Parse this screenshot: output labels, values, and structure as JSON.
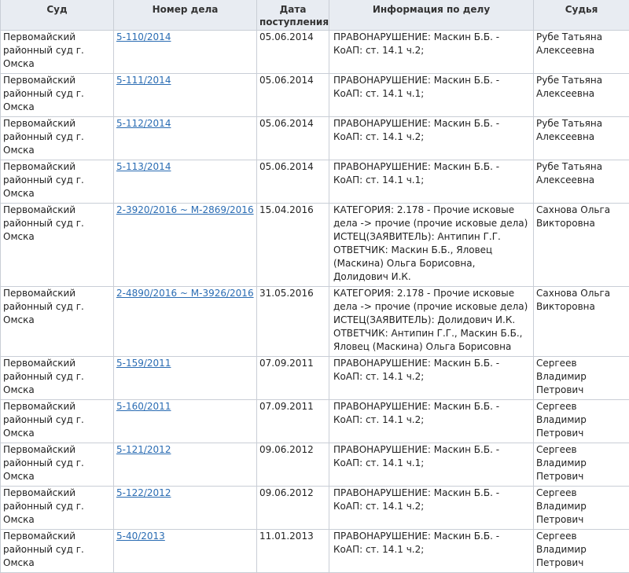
{
  "headers": [
    "Суд",
    "Номер дела",
    "Дата поступления",
    "Информация по делу",
    "Судья"
  ],
  "rows": [
    {
      "court": "Первомайский районный суд г. Омска",
      "case": "5-110/2014",
      "date": "05.06.2014",
      "info": "ПРАВОНАРУШЕНИЕ: Маскин Б.Б. - КоАП: ст. 14.1 ч.2;",
      "judge": "Рубе Татьяна Алексеевна"
    },
    {
      "court": "Первомайский районный суд г. Омска",
      "case": "5-111/2014",
      "date": "05.06.2014",
      "info": "ПРАВОНАРУШЕНИЕ: Маскин Б.Б. - КоАП: ст. 14.1 ч.1;",
      "judge": "Рубе Татьяна Алексеевна"
    },
    {
      "court": "Первомайский районный суд г. Омска",
      "case": "5-112/2014",
      "date": "05.06.2014",
      "info": "ПРАВОНАРУШЕНИЕ: Маскин Б.Б. - КоАП: ст. 14.1 ч.2;",
      "judge": "Рубе Татьяна Алексеевна"
    },
    {
      "court": "Первомайский районный суд г. Омска",
      "case": "5-113/2014",
      "date": "05.06.2014",
      "info": "ПРАВОНАРУШЕНИЕ: Маскин Б.Б. - КоАП: ст. 14.1 ч.1;",
      "judge": "Рубе Татьяна Алексеевна"
    },
    {
      "court": "Первомайский районный суд г. Омска",
      "case": "2-3920/2016 ~ М-2869/2016",
      "date": "15.04.2016",
      "info": "КАТЕГОРИЯ: 2.178 - Прочие исковые дела -> прочие (прочие исковые дела) ИСТЕЦ(ЗАЯВИТЕЛЬ): Антипин Г.Г. ОТВЕТЧИК: Маскин Б.Б., Яловец (Маскина) Ольга Борисовна, Долидович И.К.",
      "judge": "Сахнова Ольга Викторовна"
    },
    {
      "court": "Первомайский районный суд г. Омска",
      "case": "2-4890/2016 ~ М-3926/2016",
      "date": "31.05.2016",
      "info": "КАТЕГОРИЯ: 2.178 - Прочие исковые дела -> прочие (прочие исковые дела) ИСТЕЦ(ЗАЯВИТЕЛЬ): Долидович И.К. ОТВЕТЧИК: Антипин Г.Г., Маскин Б.Б., Яловец (Маскина) Ольга Борисовна",
      "judge": "Сахнова Ольга Викторовна"
    },
    {
      "court": "Первомайский районный суд г. Омска",
      "case": "5-159/2011",
      "date": "07.09.2011",
      "info": "ПРАВОНАРУШЕНИЕ: Маскин Б.Б. - КоАП: ст. 14.1 ч.2;",
      "judge": "Сергеев Владимир Петрович"
    },
    {
      "court": "Первомайский районный суд г. Омска",
      "case": "5-160/2011",
      "date": "07.09.2011",
      "info": "ПРАВОНАРУШЕНИЕ: Маскин Б.Б. - КоАП: ст. 14.1 ч.2;",
      "judge": "Сергеев Владимир Петрович"
    },
    {
      "court": "Первомайский районный суд г. Омска",
      "case": "5-121/2012",
      "date": "09.06.2012",
      "info": "ПРАВОНАРУШЕНИЕ: Маскин Б.Б. - КоАП: ст. 14.1 ч.1;",
      "judge": "Сергеев Владимир Петрович"
    },
    {
      "court": "Первомайский районный суд г. Омска",
      "case": "5-122/2012",
      "date": "09.06.2012",
      "info": "ПРАВОНАРУШЕНИЕ: Маскин Б.Б. - КоАП: ст. 14.1 ч.2;",
      "judge": "Сергеев Владимир Петрович"
    },
    {
      "court": "Первомайский районный суд г. Омска",
      "case": "5-40/2013",
      "date": "11.01.2013",
      "info": "ПРАВОНАРУШЕНИЕ: Маскин Б.Б. - КоАП: ст. 14.1 ч.2;",
      "judge": "Сергеев Владимир Петрович"
    }
  ]
}
